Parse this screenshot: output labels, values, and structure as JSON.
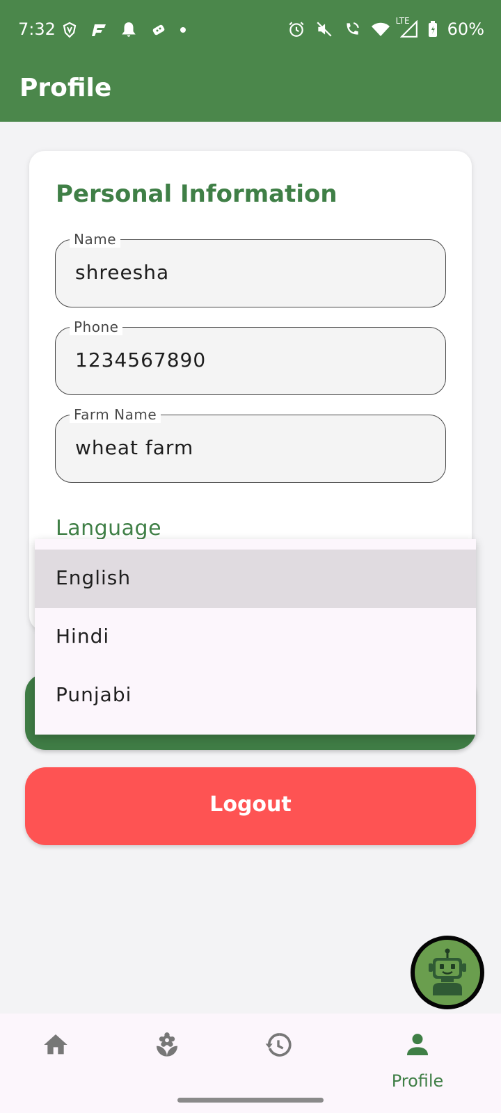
{
  "status_bar": {
    "time": "7:32",
    "network": "LTE",
    "battery": "60%"
  },
  "app_bar": {
    "title": "Profile"
  },
  "personal_info": {
    "title": "Personal Information",
    "fields": [
      {
        "label": "Name",
        "value": "shreesha"
      },
      {
        "label": "Phone",
        "value": "1234567890"
      },
      {
        "label": "Farm Name",
        "value": "wheat farm"
      }
    ]
  },
  "language": {
    "title": "Language",
    "options": [
      "English",
      "Hindi",
      "Punjabi"
    ],
    "selected": "English"
  },
  "buttons": {
    "logout": "Logout"
  },
  "bottom_nav": {
    "items": [
      {
        "icon": "home-icon",
        "label": ""
      },
      {
        "icon": "plant-icon",
        "label": ""
      },
      {
        "icon": "history-icon",
        "label": ""
      },
      {
        "icon": "person-icon",
        "label": "Profile"
      }
    ],
    "active_index": 3
  },
  "colors": {
    "primary_green": "#4b874b",
    "title_green": "#3f7f46",
    "logout_red": "#fe5353",
    "dropdown_bg": "#fcf6fc",
    "selected_option_bg": "#e0dbe0"
  }
}
